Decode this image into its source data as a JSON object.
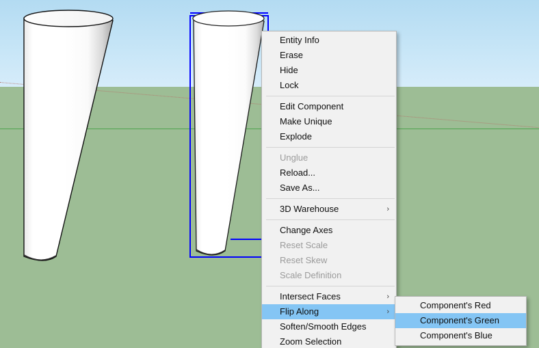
{
  "viewport": {
    "sky_color": "#c8e6f7",
    "ground_color": "#9dbd95",
    "green_axis_color": "#4ea34e",
    "red_axis_color": "#b5736a",
    "selection_color": "#0000ff",
    "objects": [
      {
        "name": "cone-unselected",
        "label": "Cone"
      },
      {
        "name": "cone-selected",
        "label": "Cone (selected component)"
      }
    ]
  },
  "context_menu": {
    "name": "component-context-menu",
    "groups": [
      {
        "items": [
          {
            "label": "Entity Info",
            "disabled": false,
            "submenu": false,
            "highlight": false
          },
          {
            "label": "Erase",
            "disabled": false,
            "submenu": false,
            "highlight": false
          },
          {
            "label": "Hide",
            "disabled": false,
            "submenu": false,
            "highlight": false
          },
          {
            "label": "Lock",
            "disabled": false,
            "submenu": false,
            "highlight": false
          }
        ]
      },
      {
        "items": [
          {
            "label": "Edit Component",
            "disabled": false,
            "submenu": false,
            "highlight": false
          },
          {
            "label": "Make Unique",
            "disabled": false,
            "submenu": false,
            "highlight": false
          },
          {
            "label": "Explode",
            "disabled": false,
            "submenu": false,
            "highlight": false
          }
        ]
      },
      {
        "items": [
          {
            "label": "Unglue",
            "disabled": true,
            "submenu": false,
            "highlight": false
          },
          {
            "label": "Reload...",
            "disabled": false,
            "submenu": false,
            "highlight": false
          },
          {
            "label": "Save As...",
            "disabled": false,
            "submenu": false,
            "highlight": false
          }
        ]
      },
      {
        "items": [
          {
            "label": "3D Warehouse",
            "disabled": false,
            "submenu": true,
            "highlight": false
          }
        ]
      },
      {
        "items": [
          {
            "label": "Change Axes",
            "disabled": false,
            "submenu": false,
            "highlight": false
          },
          {
            "label": "Reset Scale",
            "disabled": true,
            "submenu": false,
            "highlight": false
          },
          {
            "label": "Reset Skew",
            "disabled": true,
            "submenu": false,
            "highlight": false
          },
          {
            "label": "Scale Definition",
            "disabled": true,
            "submenu": false,
            "highlight": false
          }
        ]
      },
      {
        "items": [
          {
            "label": "Intersect Faces",
            "disabled": false,
            "submenu": true,
            "highlight": false
          },
          {
            "label": "Flip Along",
            "disabled": false,
            "submenu": true,
            "highlight": true
          },
          {
            "label": "Soften/Smooth Edges",
            "disabled": false,
            "submenu": false,
            "highlight": false
          },
          {
            "label": "Zoom Selection",
            "disabled": false,
            "submenu": false,
            "highlight": false
          }
        ]
      }
    ]
  },
  "flip_submenu": {
    "name": "flip-along-submenu",
    "items": [
      {
        "label": "Component's Red",
        "highlight": false
      },
      {
        "label": "Component's Green",
        "highlight": true
      },
      {
        "label": "Component's Blue",
        "highlight": false
      }
    ]
  },
  "icons": {
    "submenu_arrow": "›"
  }
}
